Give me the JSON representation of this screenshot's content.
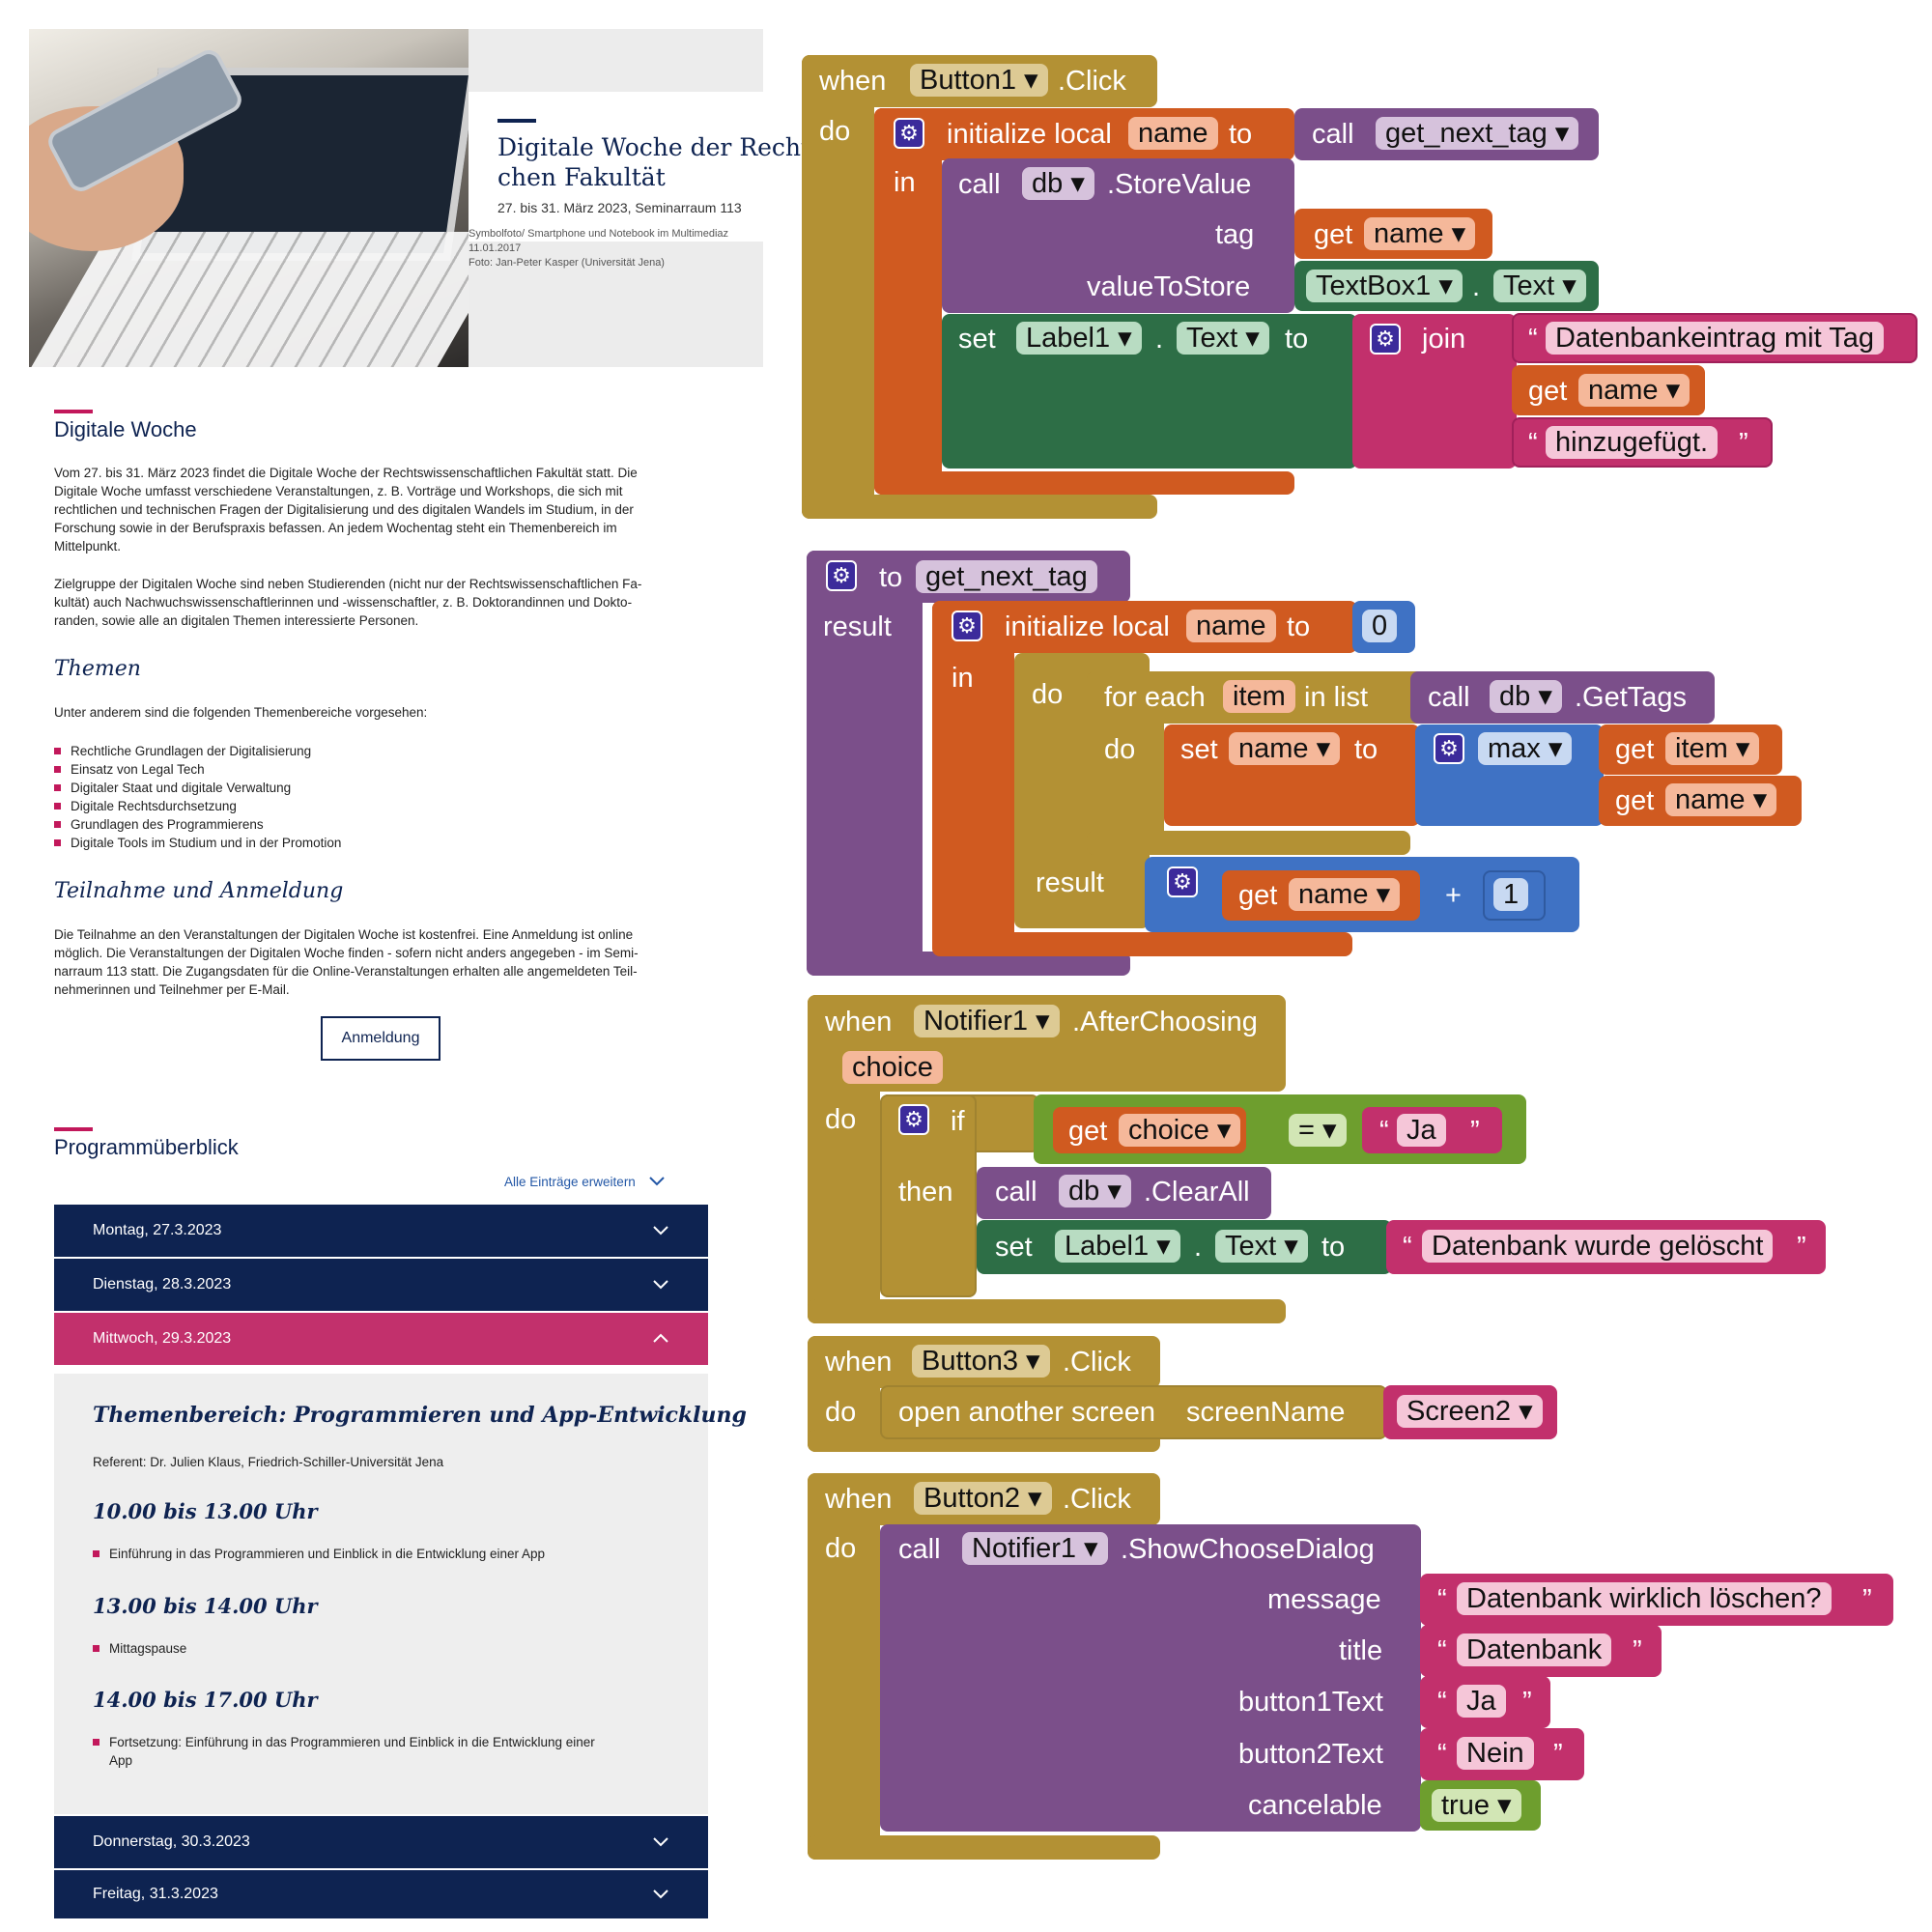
{
  "hero": {
    "title_line1": "Digitale Woche der Recht",
    "title_line2": "chen Fakultät",
    "subtitle": "27. bis 31. März 2023, Seminarraum 113",
    "caption_line1": "Symbolfoto/ Smartphone und Notebook im Multimediaz",
    "caption_line2": "11.01.2017",
    "caption_line3": "Foto: Jan-Peter Kasper (Universität Jena)"
  },
  "digitale_woche": {
    "heading": "Digitale Woche",
    "p1_lines": [
      "Vom 27. bis 31. März 2023 findet die Digitale Woche der Rechtswissenschaftlichen Fakultät statt. Die",
      "Digitale Woche umfasst verschiedene Veranstaltungen, z. B. Vorträge und Workshops, die sich mit",
      "rechtlichen und technischen Fragen der Digitalisierung und des digitalen Wandels im Studium, in der",
      "Forschung sowie in der Berufspraxis befassen. An jedem Wochentag steht ein Themenbereich im",
      "Mittelpunkt."
    ],
    "p2_lines": [
      "Zielgruppe der Digitalen Woche sind neben Studierenden (nicht nur der Rechtswissenschaftlichen Fa-",
      "kultät) auch Nachwuchswissenschaftlerinnen und -wissenschaftler, z. B. Doktorandinnen und Dokto-",
      "randen, sowie alle an digitalen Themen interessierte Personen."
    ]
  },
  "themen": {
    "heading": "Themen",
    "intro": "Unter anderem sind die folgenden Themenbereiche vorgesehen:",
    "items": [
      "Rechtliche Grundlagen der Digitalisierung",
      "Einsatz von Legal Tech",
      "Digitaler Staat und digitale Verwaltung",
      "Digitale Rechtsdurchsetzung",
      "Grundlagen des Programmierens",
      "Digitale Tools im Studium und in der Promotion"
    ]
  },
  "teilnahme": {
    "heading": "Teilnahme und Anmeldung",
    "lines": [
      "Die Teilnahme an den Veranstaltungen der Digitalen Woche ist kostenfrei. Eine Anmeldung ist online",
      "möglich. Die Veranstaltungen der Digitalen Woche finden - sofern nicht anders angegeben - im Semi-",
      "narraum 113 statt. Die Zugangsdaten für die Online-Veranstaltungen erhalten alle angemeldeten Teil-",
      "nehmerinnen und Teilnehmer per E-Mail."
    ],
    "button": "Anmeldung"
  },
  "programm": {
    "heading": "Programmüberblick",
    "expand_all": "Alle Einträge erweitern",
    "days": [
      "Montag, 27.3.2023",
      "Dienstag, 28.3.2023",
      "Mittwoch, 29.3.2023",
      "Donnerstag, 30.3.2023",
      "Freitag, 31.3.2023"
    ],
    "open_day": {
      "title": "Themenbereich: Programmieren und App-Entwicklung",
      "referent": "Referent: Dr. Julien Klaus, Friedrich-Schiller-Universität Jena",
      "slots": [
        {
          "time": "10.00 bis 13.00 Uhr",
          "items": [
            "Einführung in das Programmieren und Einblick in die Entwicklung einer App"
          ]
        },
        {
          "time": "13.00 bis 14.00 Uhr",
          "items": [
            "Mittagspause"
          ]
        },
        {
          "time": "14.00 bis 17.00 Uhr",
          "items": [
            "Fortsetzung: Einführung in das Programmieren und Einblick in die Entwicklung einer",
            "App"
          ]
        }
      ]
    }
  },
  "blocks": {
    "b1": {
      "when": "when",
      "component": "Button1",
      "event": ".Click",
      "do": "do",
      "init_local": "initialize local",
      "var_name": "name",
      "to": "to",
      "call": "call",
      "proc": "get_next_tag",
      "in": "in",
      "db": "db",
      "store": ".StoreValue",
      "tag": "tag",
      "get": "get",
      "valueToStore": "valueToStore",
      "textbox": "TextBox1",
      "dot": ".",
      "text": "Text",
      "set": "set",
      "label": "Label1",
      "join": "join",
      "str1": "Datenbankeintrag mit Tag",
      "str2": "hinzugefügt."
    },
    "b2": {
      "to": "to",
      "proc": "get_next_tag",
      "result": "result",
      "init_local": "initialize local",
      "var_name": "name",
      "zero": "0",
      "in": "in",
      "do": "do",
      "for_each": "for each",
      "item": "item",
      "in_list": "in list",
      "call": "call",
      "db": "db",
      "gettags": ".GetTags",
      "set": "set",
      "max": "max",
      "get": "get",
      "plus": "+",
      "one": "1"
    },
    "b3": {
      "when": "when",
      "component": "Notifier1",
      "event": ".AfterChoosing",
      "param": "choice",
      "do": "do",
      "if": "if",
      "get": "get",
      "eq": "=",
      "ja": "Ja",
      "then": "then",
      "call": "call",
      "db": "db",
      "clear": ".ClearAll",
      "set": "set",
      "label": "Label1",
      "dot": ".",
      "text": "Text",
      "to": "to",
      "msg": "Datenbank wurde gelöscht"
    },
    "b4": {
      "when": "when",
      "component": "Button3",
      "event": ".Click",
      "do": "do",
      "open": "open another screen",
      "screenName": "screenName",
      "screen": "Screen2"
    },
    "b5": {
      "when": "when",
      "component": "Button2",
      "event": ".Click",
      "do": "do",
      "call": "call",
      "notifier": "Notifier1",
      "method": ".ShowChooseDialog",
      "message": "message",
      "message_val": "Datenbank wirklich löschen?",
      "title": "title",
      "title_val": "Datenbank",
      "b1text": "button1Text",
      "b1_val": "Ja",
      "b2text": "button2Text",
      "b2_val": "Nein",
      "cancelable": "cancelable",
      "cancelable_val": "true"
    }
  },
  "colors": {
    "navy": "#0e2351",
    "pink": "#c2185b",
    "control": "#b39134",
    "variable": "#d05a20",
    "procedure": "#7b4f8a",
    "component_set": "#2d6e46",
    "text": "#c2306c",
    "math": "#3f72c4",
    "logic": "#6e9e2e"
  },
  "icons": [
    "gear-icon",
    "chevron-down-icon",
    "chevron-up-icon",
    "dropdown-arrow-icon"
  ]
}
